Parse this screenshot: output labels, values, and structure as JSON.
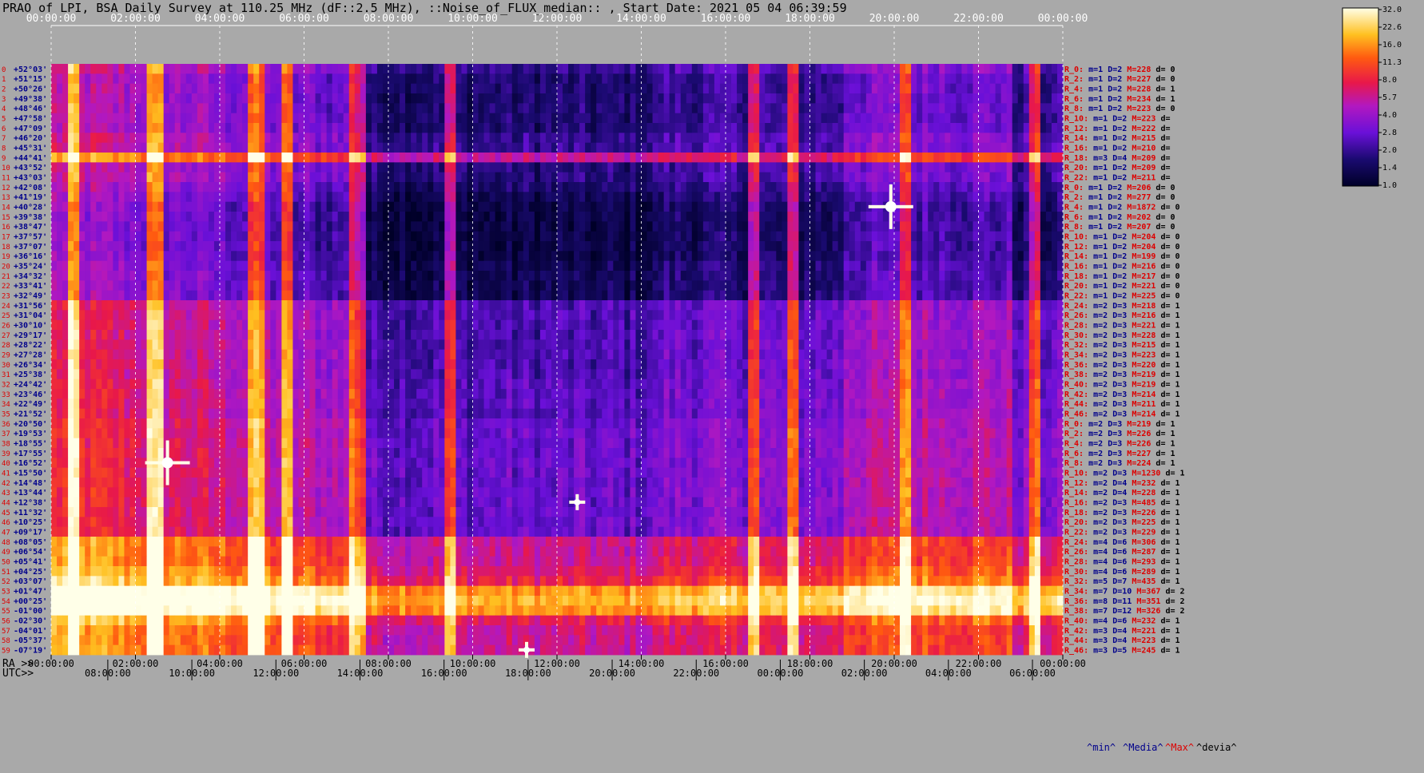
{
  "title": "PRAO of LPI, BSA Daily Survey at 110.25 MHz (dF::2.5 MHz), ::Noise_of_FLUX_median:: , Start Date: 2021 05 04 06:39:59",
  "footer": {
    "ra_prefix": "RA >>",
    "utc_prefix": "UTC>>"
  },
  "buttons": [
    {
      "label": "^min^",
      "color": "#00008b"
    },
    {
      "label": "^Media^",
      "color": "#00008b"
    },
    {
      "label": "^Max^",
      "color": "#dd0000"
    },
    {
      "label": "^devia^",
      "color": "#000000"
    }
  ],
  "colors": {
    "background": "#a9a9a9",
    "label_red": "#dd0000",
    "label_blue": "#00008b"
  },
  "chart_data": {
    "type": "heatmap",
    "title": "PRAO of LPI, BSA Daily Survey at 110.25 MHz (dF::2.5 MHz), ::Noise_of_FLUX_median:: , Start Date: 2021 05 04 06:39:59",
    "top_ticks": [
      "00:00:00",
      "02:00:00",
      "04:00:00",
      "06:00:00",
      "08:00:00",
      "10:00:00",
      "12:00:00",
      "14:00:00",
      "16:00:00",
      "18:00:00",
      "20:00:00",
      "22:00:00",
      "00:00:00"
    ],
    "ra_ticks": [
      "00:00:00",
      "02:00:00",
      "04:00:00",
      "06:00:00",
      "08:00:00",
      "10:00:00",
      "12:00:00",
      "14:00:00",
      "16:00:00",
      "18:00:00",
      "20:00:00",
      "22:00:00",
      "00:00:00"
    ],
    "utc_ticks": [
      "08:00:00",
      "10:00:00",
      "12:00:00",
      "14:00:00",
      "16:00:00",
      "18:00:00",
      "20:00:00",
      "22:00:00",
      "00:00:00",
      "02:00:00",
      "04:00:00",
      "06:00:00"
    ],
    "colorbar": {
      "ticks": [
        "32.0",
        "22.6",
        "16.0",
        "11.3",
        "8.0",
        "5.7",
        "4.0",
        "2.8",
        "2.0",
        "1.4",
        "1.0"
      ]
    },
    "rows": [
      {
        "idx": "0",
        "dec": "+52°03'",
        "r": "R_0:",
        "m": "m=1",
        "D": "D=2",
        "M": "M=228",
        "d": "d= 0"
      },
      {
        "idx": "1",
        "dec": "+51°15'",
        "r": "R_2:",
        "m": "m=1",
        "D": "D=2",
        "M": "M=227",
        "d": "d= 0"
      },
      {
        "idx": "2",
        "dec": "+50°26'",
        "r": "R_4:",
        "m": "m=1",
        "D": "D=2",
        "M": "M=228",
        "d": "d= 1"
      },
      {
        "idx": "3",
        "dec": "+49°38'",
        "r": "R_6:",
        "m": "m=1",
        "D": "D=2",
        "M": "M=234",
        "d": "d= 1"
      },
      {
        "idx": "4",
        "dec": "+48°46'",
        "r": "R_8:",
        "m": "m=1",
        "D": "D=2",
        "M": "M=223",
        "d": "d= 0"
      },
      {
        "idx": "5",
        "dec": "+47°58'",
        "r": "R_10:",
        "m": "m=1",
        "D": "D=2",
        "M": "M=223",
        "d": "d="
      },
      {
        "idx": "6",
        "dec": "+47°09'",
        "r": "R_12:",
        "m": "m=1",
        "D": "D=2",
        "M": "M=222",
        "d": "d="
      },
      {
        "idx": "7",
        "dec": "+46°20'",
        "r": "R_14:",
        "m": "m=1",
        "D": "D=2",
        "M": "M=215",
        "d": "d="
      },
      {
        "idx": "8",
        "dec": "+45°31'",
        "r": "R_16:",
        "m": "m=1",
        "D": "D=2",
        "M": "M=210",
        "d": "d="
      },
      {
        "idx": "9",
        "dec": "+44°41'",
        "r": "R_18:",
        "m": "m=3",
        "D": "D=4",
        "M": "M=209",
        "d": "d="
      },
      {
        "idx": "10",
        "dec": "+43°52'",
        "r": "R_20:",
        "m": "m=1",
        "D": "D=2",
        "M": "M=209",
        "d": "d="
      },
      {
        "idx": "11",
        "dec": "+43°03'",
        "r": "R_22:",
        "m": "m=1",
        "D": "D=2",
        "M": "M=211",
        "d": "d="
      },
      {
        "idx": "12",
        "dec": "+42°08'",
        "r": "R_0:",
        "m": "m=1",
        "D": "D=2",
        "M": "M=206",
        "d": "d= 0"
      },
      {
        "idx": "13",
        "dec": "+41°19'",
        "r": "R_2:",
        "m": "m=1",
        "D": "D=2",
        "M": "M=277",
        "d": "d= 0"
      },
      {
        "idx": "14",
        "dec": "+40°28'",
        "r": "R_4:",
        "m": "m=1",
        "D": "D=2",
        "M": "M=1872",
        "d": "d= 0"
      },
      {
        "idx": "15",
        "dec": "+39°38'",
        "r": "R_6:",
        "m": "m=1",
        "D": "D=2",
        "M": "M=202",
        "d": "d= 0"
      },
      {
        "idx": "16",
        "dec": "+38°47'",
        "r": "R_8:",
        "m": "m=1",
        "D": "D=2",
        "M": "M=207",
        "d": "d= 0"
      },
      {
        "idx": "17",
        "dec": "+37°57'",
        "r": "R_10:",
        "m": "m=1",
        "D": "D=2",
        "M": "M=204",
        "d": "d= 0"
      },
      {
        "idx": "18",
        "dec": "+37°07'",
        "r": "R_12:",
        "m": "m=1",
        "D": "D=2",
        "M": "M=204",
        "d": "d= 0"
      },
      {
        "idx": "19",
        "dec": "+36°16'",
        "r": "R_14:",
        "m": "m=1",
        "D": "D=2",
        "M": "M=199",
        "d": "d= 0"
      },
      {
        "idx": "20",
        "dec": "+35°24'",
        "r": "R_16:",
        "m": "m=1",
        "D": "D=2",
        "M": "M=216",
        "d": "d= 0"
      },
      {
        "idx": "21",
        "dec": "+34°32'",
        "r": "R_18:",
        "m": "m=1",
        "D": "D=2",
        "M": "M=217",
        "d": "d= 0"
      },
      {
        "idx": "22",
        "dec": "+33°41'",
        "r": "R_20:",
        "m": "m=1",
        "D": "D=2",
        "M": "M=221",
        "d": "d= 0"
      },
      {
        "idx": "23",
        "dec": "+32°49'",
        "r": "R_22:",
        "m": "m=1",
        "D": "D=2",
        "M": "M=225",
        "d": "d= 0"
      },
      {
        "idx": "24",
        "dec": "+31°56'",
        "r": "R_24:",
        "m": "m=2",
        "D": "D=3",
        "M": "M=218",
        "d": "d= 1"
      },
      {
        "idx": "25",
        "dec": "+31°04'",
        "r": "R_26:",
        "m": "m=2",
        "D": "D=3",
        "M": "M=216",
        "d": "d= 1"
      },
      {
        "idx": "26",
        "dec": "+30°10'",
        "r": "R_28:",
        "m": "m=2",
        "D": "D=3",
        "M": "M=221",
        "d": "d= 1"
      },
      {
        "idx": "27",
        "dec": "+29°17'",
        "r": "R_30:",
        "m": "m=2",
        "D": "D=3",
        "M": "M=228",
        "d": "d= 1"
      },
      {
        "idx": "28",
        "dec": "+28°22'",
        "r": "R_32:",
        "m": "m=2",
        "D": "D=3",
        "M": "M=215",
        "d": "d= 1"
      },
      {
        "idx": "29",
        "dec": "+27°28'",
        "r": "R_34:",
        "m": "m=2",
        "D": "D=3",
        "M": "M=223",
        "d": "d= 1"
      },
      {
        "idx": "30",
        "dec": "+26°34'",
        "r": "R_36:",
        "m": "m=2",
        "D": "D=3",
        "M": "M=220",
        "d": "d= 1"
      },
      {
        "idx": "31",
        "dec": "+25°38'",
        "r": "R_38:",
        "m": "m=2",
        "D": "D=3",
        "M": "M=219",
        "d": "d= 1"
      },
      {
        "idx": "32",
        "dec": "+24°42'",
        "r": "R_40:",
        "m": "m=2",
        "D": "D=3",
        "M": "M=219",
        "d": "d= 1"
      },
      {
        "idx": "33",
        "dec": "+23°46'",
        "r": "R_42:",
        "m": "m=2",
        "D": "D=3",
        "M": "M=214",
        "d": "d= 1"
      },
      {
        "idx": "34",
        "dec": "+22°49'",
        "r": "R_44:",
        "m": "m=2",
        "D": "D=3",
        "M": "M=211",
        "d": "d= 1"
      },
      {
        "idx": "35",
        "dec": "+21°52'",
        "r": "R_46:",
        "m": "m=2",
        "D": "D=3",
        "M": "M=214",
        "d": "d= 1"
      },
      {
        "idx": "36",
        "dec": "+20°50'",
        "r": "R_0:",
        "m": "m=2",
        "D": "D=3",
        "M": "M=219",
        "d": "d= 1"
      },
      {
        "idx": "37",
        "dec": "+19°53'",
        "r": "R_2:",
        "m": "m=2",
        "D": "D=3",
        "M": "M=226",
        "d": "d= 1"
      },
      {
        "idx": "38",
        "dec": "+18°55'",
        "r": "R_4:",
        "m": "m=2",
        "D": "D=3",
        "M": "M=226",
        "d": "d= 1"
      },
      {
        "idx": "39",
        "dec": "+17°55'",
        "r": "R_6:",
        "m": "m=2",
        "D": "D=3",
        "M": "M=227",
        "d": "d= 1"
      },
      {
        "idx": "40",
        "dec": "+16°52'",
        "r": "R_8:",
        "m": "m=2",
        "D": "D=3",
        "M": "M=224",
        "d": "d= 1"
      },
      {
        "idx": "41",
        "dec": "+15°50'",
        "r": "R_10:",
        "m": "m=2",
        "D": "D=3",
        "M": "M=1230",
        "d": "d= 1"
      },
      {
        "idx": "42",
        "dec": "+14°48'",
        "r": "R_12:",
        "m": "m=2",
        "D": "D=4",
        "M": "M=232",
        "d": "d= 1"
      },
      {
        "idx": "43",
        "dec": "+13°44'",
        "r": "R_14:",
        "m": "m=2",
        "D": "D=4",
        "M": "M=228",
        "d": "d= 1"
      },
      {
        "idx": "44",
        "dec": "+12°38'",
        "r": "R_16:",
        "m": "m=2",
        "D": "D=3",
        "M": "M=485",
        "d": "d= 1"
      },
      {
        "idx": "45",
        "dec": "+11°32'",
        "r": "R_18:",
        "m": "m=2",
        "D": "D=3",
        "M": "M=226",
        "d": "d= 1"
      },
      {
        "idx": "46",
        "dec": "+10°25'",
        "r": "R_20:",
        "m": "m=2",
        "D": "D=3",
        "M": "M=225",
        "d": "d= 1"
      },
      {
        "idx": "47",
        "dec": "+09°17'",
        "r": "R_22:",
        "m": "m=2",
        "D": "D=3",
        "M": "M=229",
        "d": "d= 1"
      },
      {
        "idx": "48",
        "dec": "+08°05'",
        "r": "R_24:",
        "m": "m=4",
        "D": "D=6",
        "M": "M=306",
        "d": "d= 1"
      },
      {
        "idx": "49",
        "dec": "+06°54'",
        "r": "R_26:",
        "m": "m=4",
        "D": "D=6",
        "M": "M=287",
        "d": "d= 1"
      },
      {
        "idx": "50",
        "dec": "+05°41'",
        "r": "R_28:",
        "m": "m=4",
        "D": "D=6",
        "M": "M=293",
        "d": "d= 1"
      },
      {
        "idx": "51",
        "dec": "+04°25'",
        "r": "R_30:",
        "m": "m=4",
        "D": "D=6",
        "M": "M=289",
        "d": "d= 1"
      },
      {
        "idx": "52",
        "dec": "+03°07'",
        "r": "R_32:",
        "m": "m=5",
        "D": "D=7",
        "M": "M=435",
        "d": "d= 1"
      },
      {
        "idx": "53",
        "dec": "+01°47'",
        "r": "R_34:",
        "m": "m=7",
        "D": "D=10",
        "M": "M=367",
        "d": "d= 2"
      },
      {
        "idx": "54",
        "dec": "+00°25'",
        "r": "R_36:",
        "m": "m=8",
        "D": "D=11",
        "M": "M=351",
        "d": "d= 2"
      },
      {
        "idx": "55",
        "dec": "-01°00'",
        "r": "R_38:",
        "m": "m=7",
        "D": "D=12",
        "M": "M=326",
        "d": "d= 2"
      },
      {
        "idx": "56",
        "dec": "-02°30'",
        "r": "R_40:",
        "m": "m=4",
        "D": "D=6",
        "M": "M=232",
        "d": "d= 1"
      },
      {
        "idx": "57",
        "dec": "-04°01'",
        "r": "R_42:",
        "m": "m=3",
        "D": "D=4",
        "M": "M=221",
        "d": "d= 1"
      },
      {
        "idx": "58",
        "dec": "-05°37'",
        "r": "R_44:",
        "m": "m=3",
        "D": "D=4",
        "M": "M=223",
        "d": "d= 1"
      },
      {
        "idx": "59",
        "dec": "-07°19'",
        "r": "R_46:",
        "m": "m=3",
        "D": "D=5",
        "M": "M=245",
        "d": "d= 1"
      }
    ],
    "intensity_levels": [
      0.25,
      0.2,
      0.2,
      0.2,
      0.2,
      0.2,
      0.2,
      0.25,
      0.25,
      0.55,
      0.22,
      0.22,
      0.18,
      0.15,
      0.12,
      0.12,
      0.12,
      0.12,
      0.12,
      0.12,
      0.15,
      0.15,
      0.15,
      0.15,
      0.3,
      0.3,
      0.3,
      0.3,
      0.3,
      0.3,
      0.3,
      0.3,
      0.32,
      0.32,
      0.32,
      0.32,
      0.35,
      0.35,
      0.35,
      0.35,
      0.35,
      0.35,
      0.35,
      0.35,
      0.35,
      0.35,
      0.35,
      0.35,
      0.55,
      0.55,
      0.55,
      0.6,
      0.65,
      0.85,
      0.9,
      0.85,
      0.62,
      0.55,
      0.55,
      0.55
    ],
    "bright_columns": [
      0.02,
      0.1,
      0.2,
      0.23,
      0.3,
      0.39,
      0.69,
      0.73,
      0.84,
      0.97
    ],
    "bright_sources": [
      {
        "x_frac": 0.83,
        "row": 14,
        "size": "large"
      },
      {
        "x_frac": 0.115,
        "row": 40,
        "size": "large"
      },
      {
        "x_frac": 0.52,
        "row": 44,
        "size": "small"
      },
      {
        "x_frac": 0.47,
        "row": 59,
        "size": "small"
      }
    ]
  }
}
